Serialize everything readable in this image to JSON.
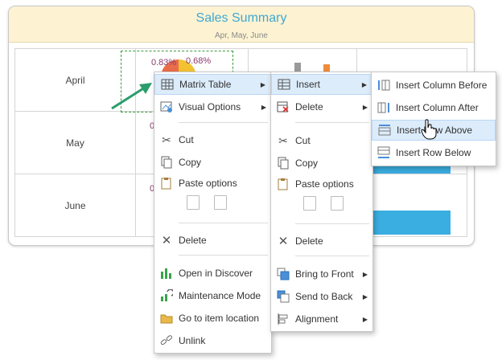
{
  "card": {
    "title": "Sales Summary",
    "subtitle": "Apr, May, June"
  },
  "rows": [
    "April",
    "May",
    "June"
  ],
  "matrix": {
    "april_label_1": "0.83%",
    "april_label_2": "0.68%",
    "may_label": "0",
    "june_label": "0"
  },
  "menu1": {
    "items": [
      {
        "label": "Matrix Table",
        "icon": "matrix-table-icon",
        "submenu": true
      },
      {
        "label": "Visual Options",
        "icon": "visual-options-icon",
        "submenu": true
      },
      {
        "label": "Cut",
        "icon": "scissors-icon"
      },
      {
        "label": "Copy",
        "icon": "copy-icon"
      },
      {
        "label": "Paste options",
        "icon": "paste-icon"
      },
      {
        "label": "Delete",
        "icon": "delete-icon"
      },
      {
        "label": "Open in Discover",
        "icon": "discover-icon"
      },
      {
        "label": "Maintenance Mode",
        "icon": "maintenance-icon"
      },
      {
        "label": "Go to item location",
        "icon": "folder-icon"
      },
      {
        "label": "Unlink",
        "icon": "unlink-icon"
      }
    ]
  },
  "menu2": {
    "items": [
      {
        "label": "Insert",
        "icon": "insert-icon",
        "submenu": true
      },
      {
        "label": "Delete",
        "icon": "delete-table-icon",
        "submenu": true
      },
      {
        "label": "Cut",
        "icon": "scissors-icon"
      },
      {
        "label": "Copy",
        "icon": "copy-icon"
      },
      {
        "label": "Paste options",
        "icon": "paste-icon"
      },
      {
        "label": "Delete",
        "icon": "delete-icon"
      },
      {
        "label": "Bring to Front",
        "icon": "bring-front-icon",
        "submenu": true
      },
      {
        "label": "Send to Back",
        "icon": "send-back-icon",
        "submenu": true
      },
      {
        "label": "Alignment",
        "icon": "alignment-icon",
        "submenu": true
      }
    ]
  },
  "menu3": {
    "items": [
      {
        "label": "Insert Column Before",
        "icon": "insert-column-before-icon"
      },
      {
        "label": "Insert Column After",
        "icon": "insert-column-after-icon"
      },
      {
        "label": "Insert Row Above",
        "icon": "insert-row-above-icon"
      },
      {
        "label": "Insert Row Below",
        "icon": "insert-row-below-icon"
      }
    ]
  },
  "colors": {
    "accent": "#3fa7d3",
    "highlight": "#dcecfb",
    "header_bg": "#fdf3d2",
    "bar": "#3aaee0",
    "arrow": "#2a9d6c"
  }
}
